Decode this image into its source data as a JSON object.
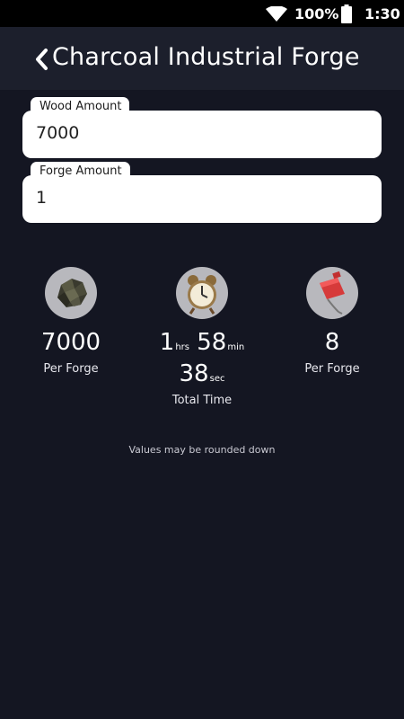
{
  "status_bar": {
    "battery_percent": "100%",
    "time": "1:30"
  },
  "app_bar": {
    "title": "Charcoal Industrial Forge"
  },
  "form": {
    "wood_amount": {
      "label": "Wood Amount",
      "value": "7000"
    },
    "forge_amount": {
      "label": "Forge Amount",
      "value": "1"
    }
  },
  "results": {
    "charcoal": {
      "icon": "charcoal-icon",
      "value": "7000",
      "caption": "Per Forge"
    },
    "time": {
      "icon": "alarm-clock-icon",
      "hours": "1",
      "hours_unit": "hrs",
      "minutes": "58",
      "minutes_unit": "min",
      "seconds": "38",
      "seconds_unit": "sec",
      "caption": "Total Time"
    },
    "fuel": {
      "icon": "fuel-can-icon",
      "value": "8",
      "caption": "Per Forge"
    }
  },
  "footnote": "Values may be rounded down",
  "colors": {
    "background": "#141622",
    "app_bar": "#1c1f2c",
    "status_bar": "#000000",
    "icon_circle": "#b8b8bd"
  }
}
